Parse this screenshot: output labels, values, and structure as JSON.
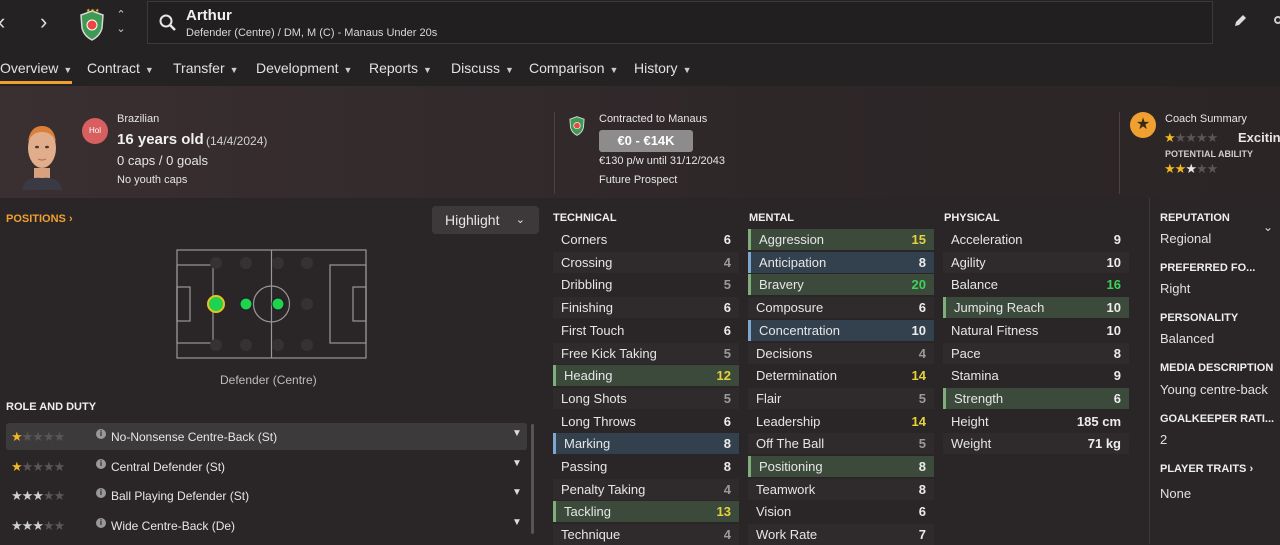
{
  "header": {
    "player_name": "Arthur",
    "player_subtitle": "Defender (Centre) / DM, M (C) - Manaus Under 20s"
  },
  "tabs": [
    "Overview",
    "Contract",
    "Transfer",
    "Development",
    "Reports",
    "Discuss",
    "Comparison",
    "History"
  ],
  "profile": {
    "nationality": "Brazilian",
    "nation_badge": "Hol",
    "age_line": "16 years old",
    "dob": "(14/4/2024)",
    "caps": "0 caps / 0 goals",
    "youth_caps": "No youth caps"
  },
  "contract": {
    "club_line": "Contracted to Manaus",
    "value": "€0 - €14K",
    "wage": "€130 p/w until 31/12/2043",
    "status": "Future Prospect"
  },
  "coach": {
    "title": "Coach Summary",
    "current_text": "Exciting",
    "potential_label": "POTENTIAL ABILITY",
    "current_ability_stars": 1,
    "potential_ability_stars": 2.5
  },
  "positions": {
    "label": "POSITIONS",
    "highlight_label": "Highlight",
    "caption": "Defender (Centre)"
  },
  "role_duty": {
    "label": "ROLE AND DUTY",
    "roles": [
      {
        "name": "No-Nonsense Centre-Back (St)",
        "stars": 1
      },
      {
        "name": "Central Defender (St)",
        "stars": 1
      },
      {
        "name": "Ball Playing Defender (St)",
        "stars": 3
      },
      {
        "name": "Wide Centre-Back (De)",
        "stars": 3
      }
    ]
  },
  "technical": {
    "label": "TECHNICAL",
    "rows": [
      [
        "Corners",
        "6"
      ],
      [
        "Crossing",
        "4"
      ],
      [
        "Dribbling",
        "5"
      ],
      [
        "Finishing",
        "6"
      ],
      [
        "First Touch",
        "6"
      ],
      [
        "Free Kick Taking",
        "5"
      ],
      [
        "Heading",
        "12"
      ],
      [
        "Long Shots",
        "5"
      ],
      [
        "Long Throws",
        "6"
      ],
      [
        "Marking",
        "8"
      ],
      [
        "Passing",
        "8"
      ],
      [
        "Penalty Taking",
        "4"
      ],
      [
        "Tackling",
        "13"
      ],
      [
        "Technique",
        "4"
      ]
    ]
  },
  "mental": {
    "label": "MENTAL",
    "rows": [
      [
        "Aggression",
        "15"
      ],
      [
        "Anticipation",
        "8"
      ],
      [
        "Bravery",
        "20"
      ],
      [
        "Composure",
        "6"
      ],
      [
        "Concentration",
        "10"
      ],
      [
        "Decisions",
        "4"
      ],
      [
        "Determination",
        "14"
      ],
      [
        "Flair",
        "5"
      ],
      [
        "Leadership",
        "14"
      ],
      [
        "Off The Ball",
        "5"
      ],
      [
        "Positioning",
        "8"
      ],
      [
        "Teamwork",
        "8"
      ],
      [
        "Vision",
        "6"
      ],
      [
        "Work Rate",
        "7"
      ]
    ]
  },
  "physical": {
    "label": "PHYSICAL",
    "rows": [
      [
        "Acceleration",
        "9"
      ],
      [
        "Agility",
        "10"
      ],
      [
        "Balance",
        "16"
      ],
      [
        "Jumping Reach",
        "10"
      ],
      [
        "Natural Fitness",
        "10"
      ],
      [
        "Pace",
        "8"
      ],
      [
        "Stamina",
        "9"
      ],
      [
        "Strength",
        "6"
      ],
      [
        "Height",
        "185 cm"
      ],
      [
        "Weight",
        "71 kg"
      ]
    ]
  },
  "side": {
    "reputation_label": "REPUTATION",
    "reputation": "Regional",
    "foot_label": "PREFERRED FO...",
    "foot": "Right",
    "personality_label": "PERSONALITY",
    "personality": "Balanced",
    "media_label": "MEDIA DESCRIPTION",
    "media": "Young centre-back",
    "gk_label": "GOALKEEPER RATI...",
    "gk": "2",
    "traits_label": "PLAYER TRAITS",
    "traits": "None"
  },
  "colors": {
    "accent": "#f0a030",
    "highlight_green": "#3c4a3c",
    "highlight_blue": "#33414f",
    "value_yellow": "#e6d23c",
    "value_green": "#3ed25a"
  }
}
